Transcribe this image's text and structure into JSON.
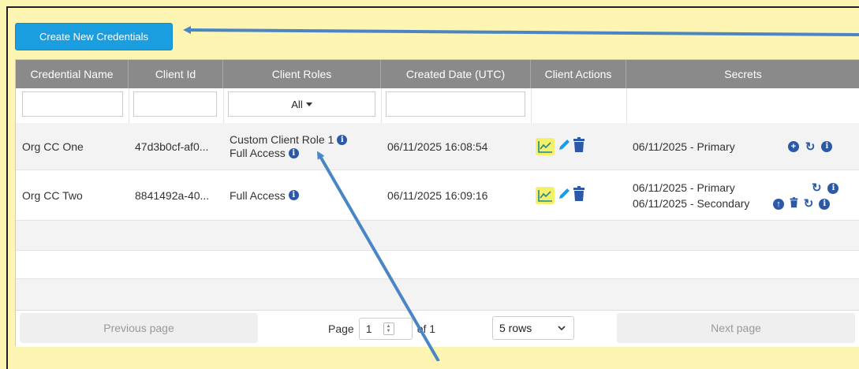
{
  "toolbar": {
    "create_label": "Create New Credentials"
  },
  "columns": [
    "Credential Name",
    "Client Id",
    "Client Roles",
    "Created Date (UTC)",
    "Client Actions",
    "Secrets"
  ],
  "filters": {
    "roles_value": "All"
  },
  "rows": [
    {
      "name": "Org CC One",
      "client_id": "47d3b0cf-af0...",
      "roles": [
        "Custom Client Role 1",
        "Full Access"
      ],
      "created": "06/11/2025 16:08:54",
      "secrets": [
        {
          "label": "06/11/2025 - Primary"
        }
      ]
    },
    {
      "name": "Org CC Two",
      "client_id": "8841492a-40...",
      "roles": [
        "Full Access"
      ],
      "created": "06/11/2025 16:09:16",
      "secrets": [
        {
          "label": "06/11/2025 - Primary"
        },
        {
          "label": "06/11/2025 - Secondary"
        }
      ]
    }
  ],
  "pagination": {
    "prev_label": "Previous page",
    "next_label": "Next page",
    "page_label": "Page",
    "page_value": "1",
    "of_label": "of 1",
    "rows_value": "5 rows"
  },
  "colors": {
    "primary": "#1a9ee0",
    "header": "#8a8a8a",
    "icon": "#2b59a8",
    "highlight": "#f4f06a",
    "annotation": "#4a86c5"
  }
}
